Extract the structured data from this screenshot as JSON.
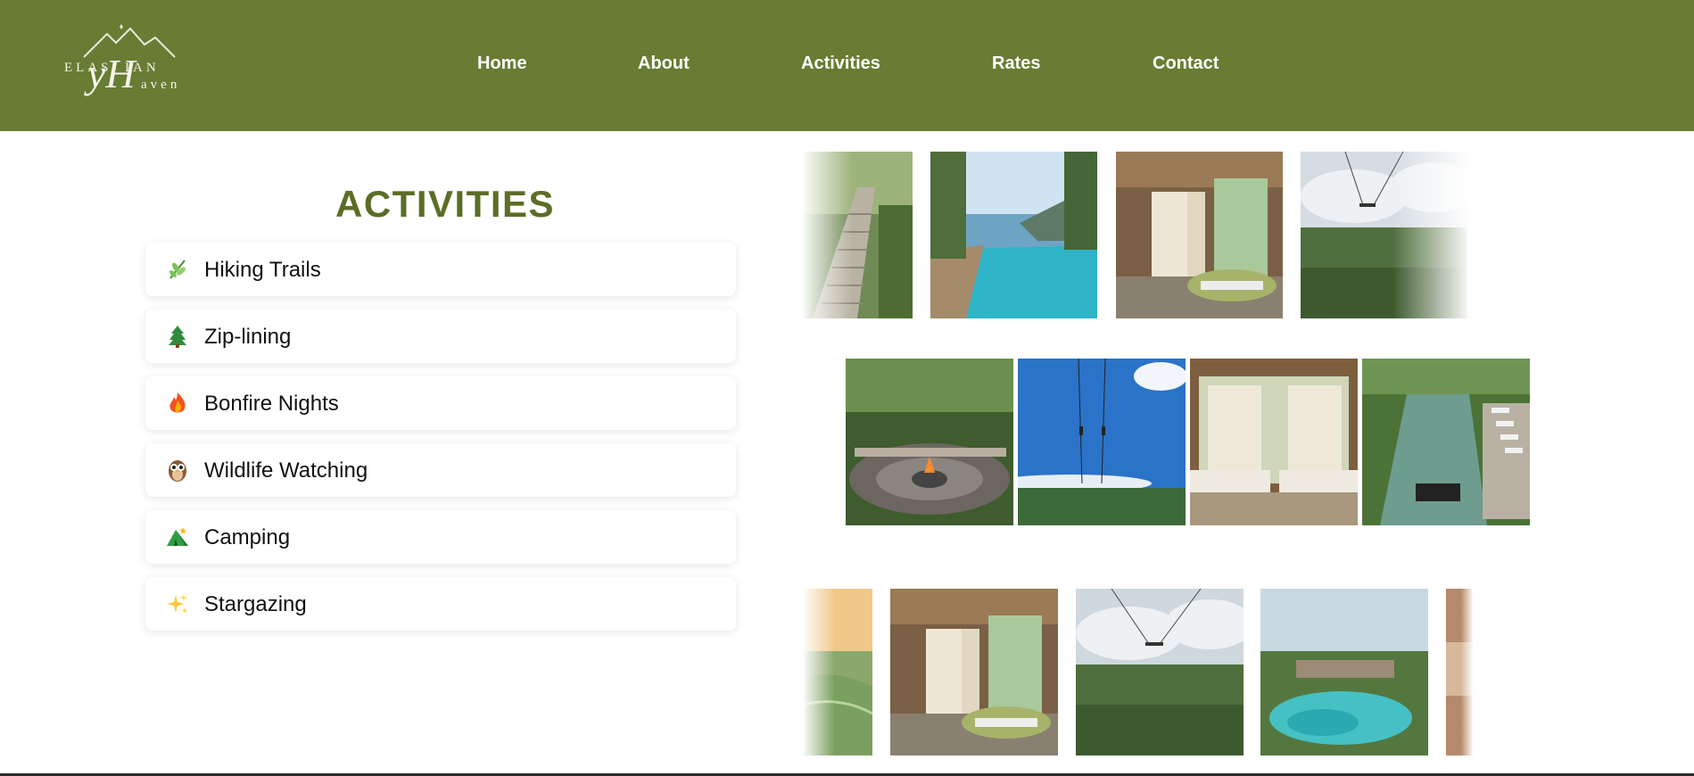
{
  "logo": {
    "line1": "ELAS",
    "line2": "IAN",
    "line3": "aven",
    "script": "yH"
  },
  "nav": [
    {
      "label": "Home"
    },
    {
      "label": "About"
    },
    {
      "label": "Activities"
    },
    {
      "label": "Rates"
    },
    {
      "label": "Contact"
    }
  ],
  "activities": {
    "title": "ACTIVITIES",
    "items": [
      {
        "label": "Hiking Trails",
        "icon": "herb-icon"
      },
      {
        "label": "Zip-lining",
        "icon": "tree-icon"
      },
      {
        "label": "Bonfire Nights",
        "icon": "fire-icon"
      },
      {
        "label": "Wildlife Watching",
        "icon": "owl-icon"
      },
      {
        "label": "Camping",
        "icon": "tent-icon"
      },
      {
        "label": "Stargazing",
        "icon": "sparkles-icon"
      }
    ]
  },
  "colors": {
    "header": "#687c33",
    "title": "#5a6e25",
    "text": "#111111"
  }
}
